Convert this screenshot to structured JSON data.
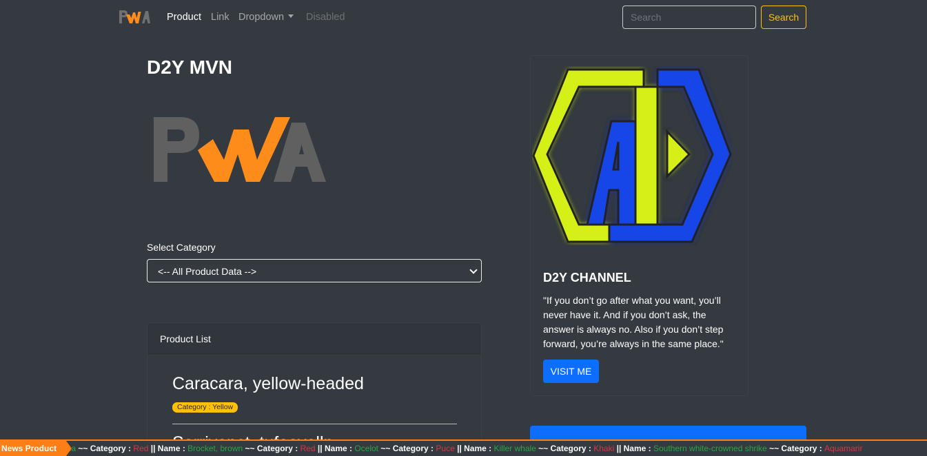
{
  "navbar": {
    "brand": "PWA",
    "links": [
      {
        "label": "Product",
        "state": "active"
      },
      {
        "label": "Link",
        "state": "normal"
      },
      {
        "label": "Dropdown",
        "state": "dropdown"
      },
      {
        "label": "Disabled",
        "state": "disabled"
      }
    ],
    "search_placeholder": "Search",
    "search_button": "Search"
  },
  "main": {
    "title": "D2Y MVN",
    "hero_logo": "PWA",
    "select_label": "Select Category",
    "select_value": "<-- All Product Data -->",
    "product_card": {
      "header": "Product List",
      "items": [
        {
          "name": "Caracara, yellow-headed",
          "badge": "Category : Yellow"
        },
        {
          "name": "Serrivanct, tufaevalln"
        }
      ]
    }
  },
  "sidebar": {
    "logo": "AD",
    "title": "D2Y CHANNEL",
    "quote": "\"If you don’t go after what you want, you’ll never have it. And if you don’t ask, the answer is always no. Also if you don’t step forward, you’re always in the same place.\"",
    "button": "VISIT ME"
  },
  "ticker": {
    "label": "News Product",
    "name_prefix": "|| Name :",
    "category_prefix": "~~ Category :",
    "lead_fragment": "ana",
    "entries": [
      {
        "category": "Red",
        "name": "Brocket, brown"
      },
      {
        "category": "Red",
        "name": "Ocelot"
      },
      {
        "category": "Puce",
        "name": "Killer whale"
      },
      {
        "category": "Khaki",
        "name": "Southern white-crowned shrike"
      },
      {
        "category": "Aquamarir",
        "name": ""
      }
    ]
  },
  "colors": {
    "background": "#343a40",
    "warning": "#ffc107",
    "primary": "#0d6efd",
    "orange": "#fd7e14",
    "success": "#28a745",
    "danger": "#dc3545"
  }
}
